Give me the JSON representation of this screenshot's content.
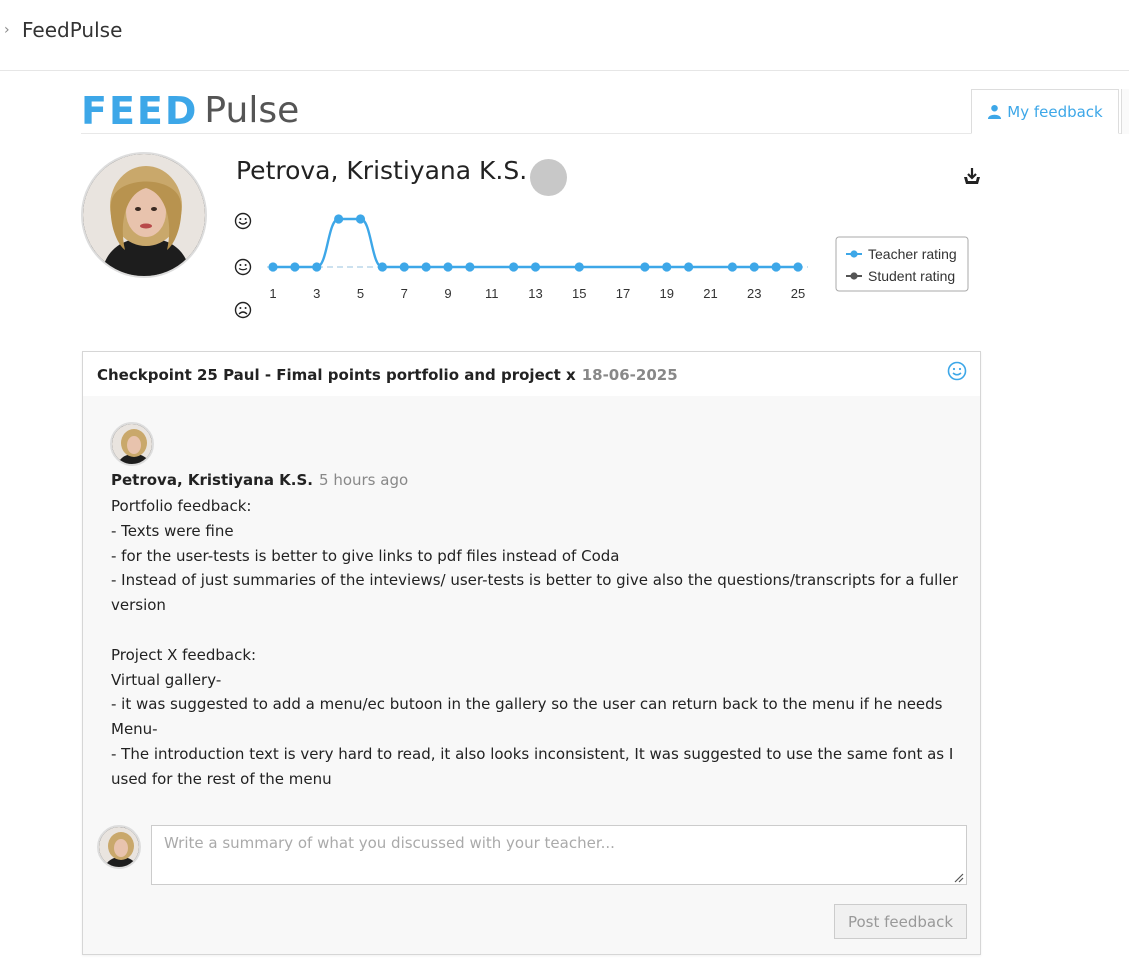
{
  "topbar": {
    "chevron": "›",
    "app_title": "FeedPulse"
  },
  "logo": {
    "part1": "FEED",
    "part2": "Pulse",
    "brand_color": "#3da7e8"
  },
  "tabs": [
    {
      "label": "My feedback",
      "icon": "user-icon",
      "active": true
    }
  ],
  "profile": {
    "name": "Petrova, Kristiyana K.S.",
    "status_color": "#c8c8c8"
  },
  "chart_data": {
    "type": "line",
    "x": [
      1,
      2,
      3,
      4,
      5,
      6,
      7,
      8,
      9,
      10,
      11,
      12,
      13,
      14,
      15,
      16,
      17,
      18,
      19,
      20,
      21,
      22,
      23,
      24,
      25
    ],
    "xticks": [
      "1",
      "3",
      "5",
      "7",
      "9",
      "11",
      "13",
      "15",
      "17",
      "19",
      "21",
      "23",
      "25"
    ],
    "y_levels": [
      "happy",
      "neutral",
      "sad"
    ],
    "y_icons": [
      "☺",
      "☺",
      "☹"
    ],
    "series": [
      {
        "name": "Teacher rating",
        "color": "#3da7e8",
        "points": [
          [
            1,
            0
          ],
          [
            2,
            0
          ],
          [
            3,
            0
          ],
          [
            4,
            1
          ],
          [
            5,
            1
          ],
          [
            6,
            0
          ],
          [
            7,
            0
          ],
          [
            8,
            0
          ],
          [
            9,
            0
          ],
          [
            10,
            0
          ],
          [
            12,
            0
          ],
          [
            13,
            0
          ],
          [
            15,
            0
          ],
          [
            18,
            0
          ],
          [
            19,
            0
          ],
          [
            20,
            0
          ],
          [
            22,
            0
          ],
          [
            23,
            0
          ],
          [
            24,
            0
          ],
          [
            25,
            0
          ]
        ]
      },
      {
        "name": "Student rating",
        "color": "#555555",
        "points": []
      }
    ],
    "legend_position": "right"
  },
  "checkpoint": {
    "title": "Checkpoint 25  Paul - Fimal points portfolio and project x",
    "date": "18-06-2025",
    "rating_icon": "smile-icon"
  },
  "message": {
    "author": "Petrova, Kristiyana K.S.",
    "time": "5 hours ago",
    "lines": [
      "Portfolio feedback:",
      "- Texts were fine",
      "- for the user-tests is better to give links to pdf files instead of Coda",
      "- Instead of just summaries of the inteviews/ user-tests is better to give also the questions/transcripts for a fuller version",
      "",
      "Project X feedback:",
      "Virtual gallery-",
      "- it was suggested to add a menu/ec butoon in the gallery so the user can return back to the menu if he needs",
      "Menu-",
      "- The introduction text is very hard to read, it also looks inconsistent, It was suggested to use the same font as I used for the rest of the menu"
    ]
  },
  "reply": {
    "placeholder": "Write a summary of what you discussed with your teacher...",
    "value": "",
    "button_label": "Post feedback"
  }
}
